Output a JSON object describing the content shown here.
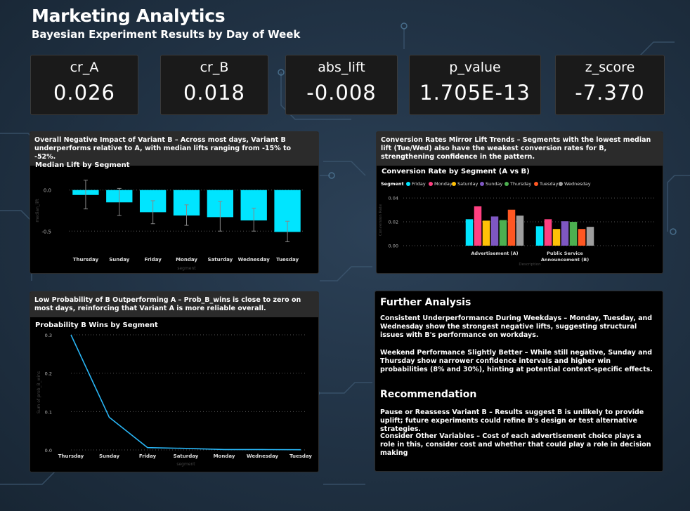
{
  "header": {
    "title": "Marketing Analytics",
    "subtitle": "Bayesian Experiment Results by Day of Week"
  },
  "kpis": [
    {
      "label": "cr_A",
      "value": "0.026"
    },
    {
      "label": "cr_B",
      "value": "0.018"
    },
    {
      "label": "abs_lift",
      "value": "-0.008"
    },
    {
      "label": "p_value",
      "value": "1.705E-13"
    },
    {
      "label": "z_score",
      "value": "-7.370"
    }
  ],
  "panels": {
    "median": {
      "header": "Overall Negative Impact of Variant B – Across most days, Variant B underperforms relative to A, with median lifts ranging from -15% to -52%.",
      "title": "Median Lift by Segment"
    },
    "conversion": {
      "header": "Conversion Rates Mirror Lift Trends – Segments with the lowest median lift (Tue/Wed) also have the weakest conversion rates for B, strengthening confidence in the pattern.",
      "title": "Conversion Rate by Segment (A vs B)"
    },
    "prob": {
      "header": "Low Probability of B Outperforming A – Prob_B_wins is close to zero on most days, reinforcing that Variant A is more reliable overall.",
      "title": "Probability B Wins by Segment"
    }
  },
  "analysis": {
    "heading1": "Further Analysis",
    "p1": "Consistent Underperformance During Weekdays – Monday, Tuesday, and Wednesday show the strongest negative lifts, suggesting structural issues with B's performance on workdays.",
    "p2": "Weekend Performance Slightly Better – While still negative, Sunday and Thursday show narrower confidence intervals and higher win probabilities (8% and 30%), hinting at potential context-specific effects.",
    "heading2": "Recommendation",
    "p3": "Pause or Reassess Variant B – Results suggest B is unlikely to provide uplift; future experiments could refine B's design or test alternative strategies.",
    "p4": "Consider Other Variables – Cost of each advertisement choice plays a role in this, consider cost and whether that could play a role in decision making"
  },
  "chart_data": [
    {
      "type": "bar",
      "title": "Median Lift by Segment",
      "xlabel": "segment",
      "ylabel": "median_lift",
      "categories": [
        "Thursday",
        "Sunday",
        "Friday",
        "Monday",
        "Saturday",
        "Wednesday",
        "Tuesday"
      ],
      "values": [
        -0.06,
        -0.15,
        -0.27,
        -0.31,
        -0.33,
        -0.37,
        -0.51
      ],
      "error_low": [
        -0.23,
        -0.31,
        -0.41,
        -0.43,
        -0.5,
        -0.5,
        -0.63
      ],
      "error_high": [
        0.12,
        0.02,
        -0.13,
        -0.18,
        -0.14,
        -0.22,
        -0.38
      ],
      "yticks": [
        "0.0",
        "-0.5"
      ],
      "ylim": [
        -0.66,
        0.16
      ],
      "grid": true,
      "color": "#00E5FF"
    },
    {
      "type": "bar",
      "title": "Conversion Rate by Segment (A vs B)",
      "xlabel": "Description",
      "ylabel": "Conversion Rate",
      "legend_title": "Segment",
      "legend_position": "top-left",
      "categories": [
        "Advertisement (A)",
        "Public Service Announcement (B)"
      ],
      "yticks": [
        "0.00",
        "0.02",
        "0.04"
      ],
      "ylim": [
        0,
        0.043
      ],
      "series": [
        {
          "name": "Friday",
          "color": "#00E5FF",
          "values": [
            0.0222,
            0.0163
          ]
        },
        {
          "name": "Monday",
          "color": "#FF4081",
          "values": [
            0.033,
            0.0222
          ]
        },
        {
          "name": "Saturday",
          "color": "#FFC107",
          "values": [
            0.021,
            0.014
          ]
        },
        {
          "name": "Sunday",
          "color": "#7E57C2",
          "values": [
            0.0245,
            0.0205
          ]
        },
        {
          "name": "Thursday",
          "color": "#4CAF50",
          "values": [
            0.0215,
            0.02
          ]
        },
        {
          "name": "Tuesday",
          "color": "#FF5722",
          "values": [
            0.0302,
            0.014
          ]
        },
        {
          "name": "Wednesday",
          "color": "#9E9E9E",
          "values": [
            0.0252,
            0.0158
          ]
        }
      ]
    },
    {
      "type": "line",
      "title": "Probability B Wins by Segment",
      "xlabel": "segment",
      "ylabel": "Sum of prob_B_wins",
      "categories": [
        "Thursday",
        "Sunday",
        "Friday",
        "Saturday",
        "Monday",
        "Wednesday",
        "Tuesday"
      ],
      "values": [
        0.3,
        0.085,
        0.006,
        0.004,
        0.001,
        0.001,
        0.0005
      ],
      "yticks": [
        "0.0",
        "0.1",
        "0.2",
        "0.3"
      ],
      "ylim": [
        0,
        0.3
      ],
      "grid": true,
      "color": "#29B6F6"
    }
  ]
}
